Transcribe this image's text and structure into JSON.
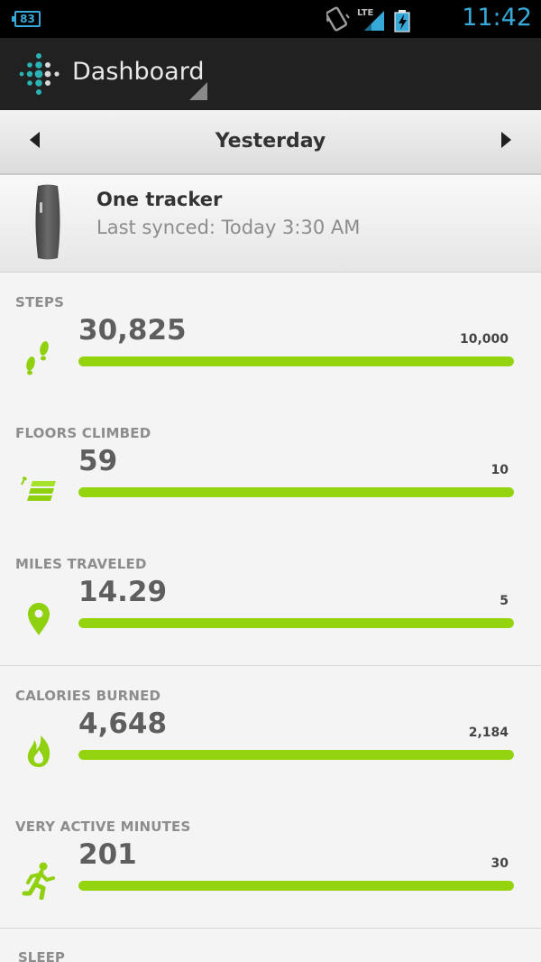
{
  "status_bar": {
    "battery_level": "83",
    "network": "LTE",
    "time": "11:42"
  },
  "action_bar": {
    "title": "Dashboard",
    "logo_icon": "fitbit-logo-icon"
  },
  "date_nav": {
    "label": "Yesterday",
    "prev_icon": "chevron-left-icon",
    "next_icon": "chevron-right-icon"
  },
  "tracker": {
    "name": "One tracker",
    "synced": "Last synced: Today 3:30 AM"
  },
  "stats": [
    {
      "label": "STEPS",
      "value": "30,825",
      "goal": "10,000",
      "progress": 1.0,
      "icon": "footprints-icon"
    },
    {
      "label": "FLOORS CLIMBED",
      "value": "59",
      "goal": "10",
      "progress": 1.0,
      "icon": "stairs-icon"
    },
    {
      "label": "MILES TRAVELED",
      "value": "14.29",
      "goal": "5",
      "progress": 1.0,
      "icon": "map-pin-icon"
    },
    {
      "label": "CALORIES BURNED",
      "value": "4,648",
      "goal": "2,184",
      "progress": 1.0,
      "icon": "flame-icon"
    },
    {
      "label": "VERY ACTIVE MINUTES",
      "value": "201",
      "goal": "30",
      "progress": 1.0,
      "icon": "running-icon"
    }
  ],
  "sleep_label": "SLEEP",
  "colors": {
    "accent_green": "#94d40e",
    "status_blue": "#36a9d8",
    "action_bar": "#212121"
  }
}
